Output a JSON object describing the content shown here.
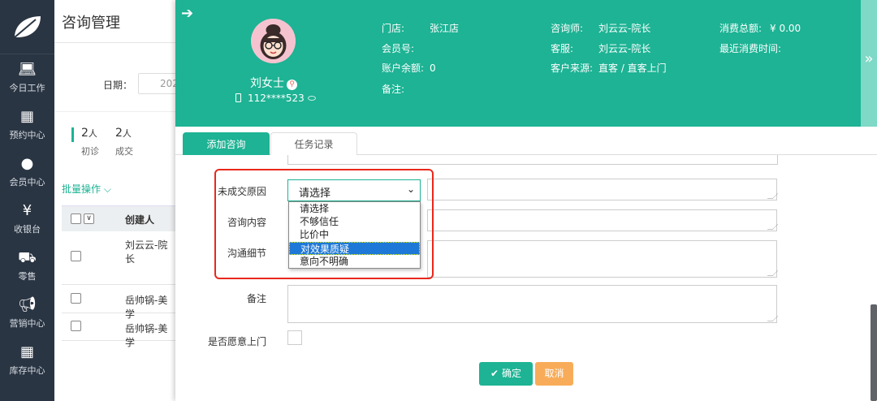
{
  "nav": {
    "items": [
      {
        "label": "今日工作",
        "icon": "laptop-icon"
      },
      {
        "label": "预约中心",
        "icon": "calendar-icon"
      },
      {
        "label": "会员中心",
        "icon": "users-icon"
      },
      {
        "label": "收银台",
        "icon": "yen-icon"
      },
      {
        "label": "零售",
        "icon": "cart-icon"
      },
      {
        "label": "营销中心",
        "icon": "megaphone-icon"
      },
      {
        "label": "库存中心",
        "icon": "grid-icon"
      }
    ]
  },
  "page": {
    "title": "咨询管理",
    "date_label": "日期：",
    "date_value": "202",
    "stats": [
      {
        "value": "2",
        "unit": "人",
        "label": "初诊"
      },
      {
        "value": "2",
        "unit": "人",
        "label": "成交"
      }
    ],
    "batch_label": "批量操作",
    "table": {
      "header": "创建人",
      "rows": [
        "刘云云-院长",
        "岳帅锅-美学",
        "岳帅锅-美学"
      ]
    }
  },
  "customer": {
    "name": "刘女士",
    "phone": "112****523",
    "info": [
      {
        "label": "门店:",
        "value": "张江店"
      },
      {
        "label": "会员号:",
        "value": ""
      },
      {
        "label": "账户余额:",
        "value": "0"
      },
      {
        "label": "备注:",
        "value": ""
      },
      {
        "label": "咨询师:",
        "value": "刘云云-院长"
      },
      {
        "label": "客服:",
        "value": "刘云云-院长"
      },
      {
        "label": "客户来源:",
        "value": "直客 / 直客上门"
      },
      {
        "label": "消费总额:",
        "value": "¥ 0.00"
      },
      {
        "label": "最近消费时间:",
        "value": ""
      }
    ]
  },
  "tabs": [
    {
      "label": "添加咨询",
      "active": true
    },
    {
      "label": "任务记录",
      "active": false
    }
  ],
  "form": {
    "reason_label": "未成交原因",
    "reason_selected": "请选择",
    "reason_options": [
      "请选择",
      "不够信任",
      "比价中",
      "对效果质疑",
      "意向不明确"
    ],
    "highlighted_option": "对效果质疑",
    "content_label": "咨询内容",
    "detail_label": "沟通细节",
    "note_label": "备注",
    "visit_label": "是否愿意上门",
    "confirm_label": "确定",
    "cancel_label": "取消"
  },
  "colors": {
    "accent": "#1db394",
    "cancel": "#f8ac59",
    "highlight": "#1e78d7",
    "annotation": "#e8281c",
    "nav": "#2a3543"
  }
}
